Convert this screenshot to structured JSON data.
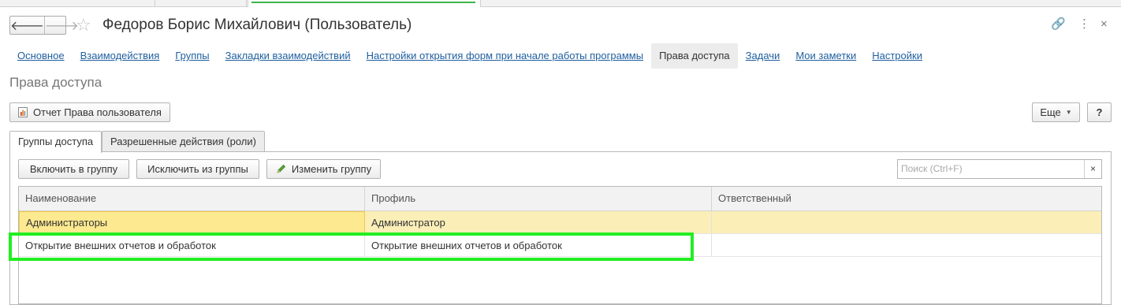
{
  "window": {
    "title": "Федоров Борис Михайлович (Пользователь)",
    "back_icon": "arrow-left-icon",
    "forward_icon": "arrow-right-icon",
    "favorite_icon": "star-icon",
    "link_icon": "link-icon",
    "more_icon": "more-vertical-icon",
    "close_icon": "close-icon",
    "link_glyph": "🔗",
    "more_glyph": "⋮",
    "close_glyph": "×"
  },
  "tabs": [
    {
      "label": "Основное",
      "active": false
    },
    {
      "label": "Взаимодействия",
      "active": false
    },
    {
      "label": "Группы",
      "active": false
    },
    {
      "label": "Закладки взаимодействий",
      "active": false
    },
    {
      "label": "Настройки открытия форм при начале работы программы",
      "active": false
    },
    {
      "label": "Права доступа",
      "active": true
    },
    {
      "label": "Задачи",
      "active": false
    },
    {
      "label": "Мои заметки",
      "active": false
    },
    {
      "label": "Настройки",
      "active": false
    }
  ],
  "section_title": "Права доступа",
  "toolbar": {
    "report_label": "Отчет Права пользователя",
    "report_icon": "report-icon",
    "more_label": "Еще",
    "help_label": "?"
  },
  "panel_tabs": [
    "Группы доступа",
    "Разрешенные действия (роли)"
  ],
  "group_toolbar": {
    "include_label": "Включить в группу",
    "exclude_label": "Исключить из группы",
    "edit_label": "Изменить группу",
    "edit_icon": "pencil-icon",
    "search_placeholder": "Поиск (Ctrl+F)",
    "search_clear": "×"
  },
  "table": {
    "columns": [
      "Наименование",
      "Профиль",
      "Ответственный"
    ],
    "rows": [
      {
        "name": "Администраторы",
        "profile": "Администратор",
        "responsible": "",
        "selected": true
      },
      {
        "name": "Открытие внешних отчетов и обработок",
        "profile": "Открытие внешних отчетов и обработок",
        "responsible": "",
        "selected": false
      }
    ]
  },
  "colors": {
    "link": "#1f5f9f",
    "selected_row": "#fbeeb7",
    "highlight_box": "#22ee22"
  }
}
